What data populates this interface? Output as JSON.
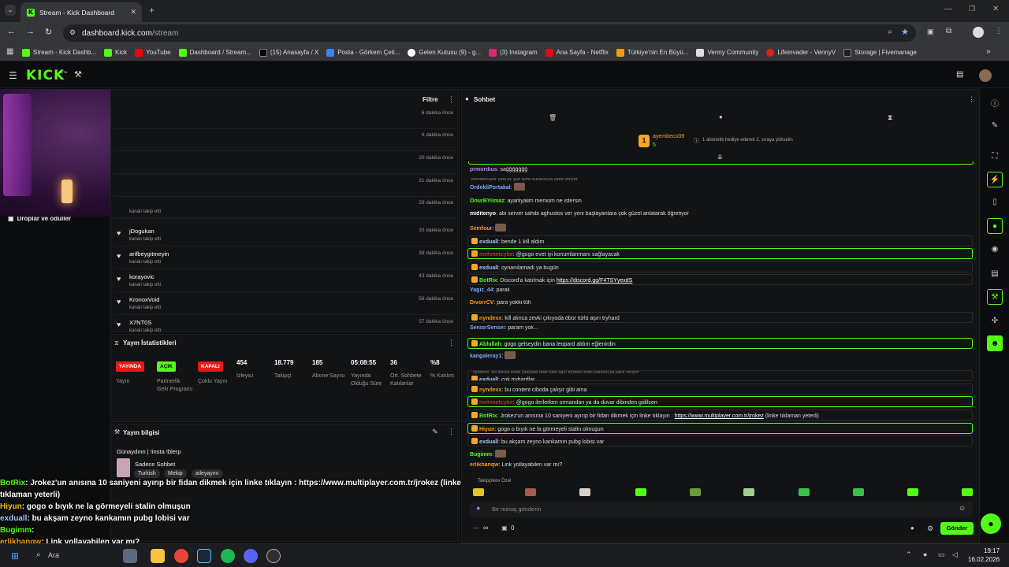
{
  "browser": {
    "tab_title": "Stream - Kick Dashboard",
    "url_host": "dashboard.kick.com",
    "url_path": "/stream",
    "bookmarks": [
      "Stream - Kick Dashb...",
      "Kick",
      "YouTube",
      "Dashboard / Stream...",
      "(15) Anasayfa / X",
      "Posta - Görkem Çeti...",
      "Gelen Kutusu (9) - g...",
      "(3) Instagram",
      "Ana Sayfa - Netflix",
      "Türkiye'nin En Büyü...",
      "Venny Community",
      "Lifeinvader - VennyV",
      "Storage | Fivemanage"
    ]
  },
  "kick": {
    "logo": "KICK",
    "beta": "BETA"
  },
  "activity": {
    "filter_label": "Filtre",
    "drops_label": "Droplar ve ödüller",
    "rows": [
      {
        "name": "",
        "sub": "",
        "time": "6 dakika önce"
      },
      {
        "name": "",
        "sub": "",
        "time": "6 dakika önce"
      },
      {
        "name": "",
        "sub": "",
        "time": "20 dakika önce"
      },
      {
        "name": "",
        "sub": "",
        "time": "21 dakika önce"
      },
      {
        "name": "",
        "sub": "kanalı takip etti",
        "time": "29 dakika önce"
      },
      {
        "name": "jDogukan",
        "sub": "kanalı takip etti",
        "time": "33 dakika önce"
      },
      {
        "name": "arifbeygitmeyin",
        "sub": "kanalı takip etti",
        "time": "39 dakika önce"
      },
      {
        "name": "korayovic",
        "sub": "kanalı takip etti",
        "time": "43 dakika önce"
      },
      {
        "name": "KronoxVoid",
        "sub": "kanalı takip etti",
        "time": "56 dakika önce"
      },
      {
        "name": "X7NT0S",
        "sub": "kanalı takip etti",
        "time": "57 dakika önce"
      }
    ]
  },
  "stats": {
    "title": "Yayın İstatistikleri",
    "badges": [
      {
        "label": "YAYINDA",
        "desc": "Yayın",
        "color": "#e91916",
        "fg": "#ffffff"
      },
      {
        "label": "AÇIK",
        "desc": "Partnerlik Gelir Programı",
        "color": "#53fc18",
        "fg": "#000000"
      },
      {
        "label": "KAPALI",
        "desc": "Çoklu Yayın",
        "color": "#e91916",
        "fg": "#ffffff"
      }
    ],
    "values": [
      {
        "v": "454",
        "l": "İzleyici"
      },
      {
        "v": "18.779",
        "l": "Takipçi"
      },
      {
        "v": "185",
        "l": "Abone Sayısı"
      },
      {
        "v": "05:08:55",
        "l": "Yayında Olduğu Süre"
      },
      {
        "v": "36",
        "l": "Ort. Sohbete Katılanlar"
      },
      {
        "v": "%8",
        "l": "% Katılım"
      }
    ]
  },
  "info": {
    "title": "Yayın bilgisi",
    "stream_title": "Günaydınn | !insta !blerp",
    "category": "Sadece Sohbet",
    "tags": [
      "Turkish",
      "Mekip",
      "aileyayını"
    ]
  },
  "chat": {
    "title": "Sohbet",
    "pinned_user": "ayembeco39",
    "pinned_count": "5",
    "pinned_text": "1 abonelik hediye ederek 2. sıraya yükselin",
    "messages": [
      {
        "u": "prmordius",
        "c": "#a78bfa",
        "t": "sağğğğğğğ",
        "style": "pl"
      },
      {
        "u": "OrdekliPortakal",
        "c": "#7aa7ff",
        "t": "",
        "style": "pl",
        "emote": true,
        "reply": "MehmetSaid: yeni pc şart isimli kullanıcıya yanıt veriyor"
      },
      {
        "u": "OnurBYilmaz",
        "c": "#53fc18",
        "t": "ayarliyalim memom ne istersin",
        "style": "pl"
      },
      {
        "u": "miditenyo",
        "c": "#ffffff",
        "t": "abi server sahibi aghustos ver yeni başlayanlara çok güzel anlatarak öğretiyor",
        "style": "pl"
      },
      {
        "u": "Semfour",
        "c": "#f59e0b",
        "t": "",
        "style": "pl",
        "emote": true
      },
      {
        "u": "exduall",
        "c": "#a3c4ff",
        "t": "bende 1 kill aldım",
        "style": "bx"
      },
      {
        "u": "mehmetcybe",
        "c": "#e91916",
        "t": "@gogo evet iyi konumlanmanı sağlayacak",
        "style": "hl"
      },
      {
        "u": "exduall",
        "c": "#a3c4ff",
        "t": "oynanılamadı ya bugün",
        "style": "bx"
      },
      {
        "u": "BotRix",
        "c": "#53fc18",
        "t": "Discord'a katılmak için",
        "link": "https://discord.gg/F4TSYyexdS",
        "style": "bx"
      },
      {
        "u": "Yagiz_44",
        "c": "#7aa7ff",
        "t": "parali",
        "style": "pl"
      },
      {
        "u": "DivorrCV",
        "c": "#f59e0b",
        "t": "para yokki tüh",
        "style": "pl"
      },
      {
        "u": "nyndexx",
        "c": "#f59e0b",
        "t": "kill alınca zevki çıkıyoda öbür türlü aşırı tryhard",
        "style": "bx"
      },
      {
        "u": "SeniorSensei",
        "c": "#7aa7ff",
        "t": "param yok...",
        "style": "pl"
      },
      {
        "u": "Ablullah",
        "c": "#53fc18",
        "t": "gogo gelseydin bana leopard aldım eğlenirdin",
        "style": "hl"
      },
      {
        "u": "kangaleray1",
        "c": "#7aa7ff",
        "t": "",
        "style": "pl",
        "emote": true
      },
      {
        "u": "exduall",
        "c": "#a3c4ff",
        "t": "çok tryhardlar",
        "style": "bx",
        "reply": "nyndexx: kill alınca zevki çıkıyoda öbür türlü aşırı tryhard isimli kullanıcıya yanıt veriyor"
      },
      {
        "u": "nyndexx",
        "c": "#f59e0b",
        "t": "bu content ciboda çalışır gibi ama",
        "style": "bx"
      },
      {
        "u": "mehmetcybe",
        "c": "#e91916",
        "t": "@gogo ilerlerken ormandan ya da duvar dibinden gidilcen",
        "style": "hl"
      },
      {
        "u": "BotRix",
        "c": "#53fc18",
        "t": "Jrokez'un anısına 10 saniyeni ayırıp bir fidan dikmek için linke tıklayın :",
        "link": "https://www.multiplayer.com.tr/jrokez",
        "tail": "(linke tıklaman yeterli)",
        "style": "bx"
      },
      {
        "u": "Hiyun",
        "c": "#f59e0b",
        "t": "gogo o bıyık ne la görmeyeli stalin olmuşun",
        "style": "hl"
      },
      {
        "u": "exduall",
        "c": "#a3c4ff",
        "t": "bu akşam zeyno kankamın pubg lobisi var",
        "style": "bx"
      },
      {
        "u": "Bugimm",
        "c": "#53fc18",
        "t": "",
        "style": "pl",
        "emote": true
      },
      {
        "u": "erlikhanqw",
        "c": "#f59e0b",
        "t": "Link yollayabilen var mı?",
        "style": "pl"
      }
    ],
    "supporters_label": "Takipçilere Özel",
    "input_placeholder": "Bir mesaj gönderin",
    "send_label": "Gönder",
    "count_a": "∞",
    "count_b": "0"
  },
  "overlay": [
    {
      "u": "BotRix",
      "t": ": Jrokez'un anısına 10 saniyeni ayırıp bir fidan dikmek için linke tıklayın : https://www.multiplayer.com.tr/jrokez (linke tıklaman yeterli)",
      "c": "#53fc18"
    },
    {
      "u": "Hiyun",
      "t": ": gogo o bıyık ne la görmeyeli stalin olmuşun",
      "c": "#f5c518"
    },
    {
      "u": "exduall",
      "t": ": bu akşam zeyno kankamın pubg lobisi var",
      "c": "#a3c4ff"
    },
    {
      "u": "Bugimm",
      "t": ":",
      "c": "#53fc18"
    },
    {
      "u": "erlikhanqw",
      "t": ": Link yollayabilen var mı?",
      "c": "#f59e0b"
    }
  ],
  "taskbar": {
    "search": "Ara",
    "time": "19:17",
    "date": "16.02.2026"
  }
}
